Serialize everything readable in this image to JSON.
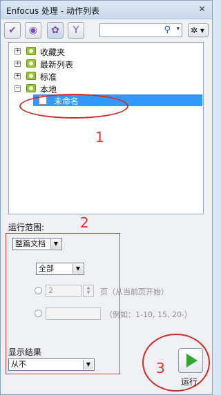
{
  "window": {
    "title": "Enfocus 处理 - 动作列表",
    "close_glyph": "✕"
  },
  "toolbar": {
    "buttons": [
      {
        "name": "checkmark-icon",
        "glyph": "✔",
        "color": "#7b4fb5"
      },
      {
        "name": "globe-icon",
        "glyph": "◉",
        "color": "#7b4fb5"
      },
      {
        "name": "gear-icon",
        "glyph": "✿",
        "color": "#7b4fb5"
      },
      {
        "name": "filter-icon",
        "glyph": "Y",
        "color": "#7b4fb5"
      }
    ],
    "search": {
      "value": "",
      "icon": "⚲",
      "caret": "▾"
    },
    "gear_menu": {
      "glyph": "✲ ▾"
    }
  },
  "tree": {
    "nodes": [
      {
        "label": "收藏夹",
        "expander": "+"
      },
      {
        "label": "最新列表",
        "expander": "+"
      },
      {
        "label": "标准",
        "expander": "+"
      },
      {
        "label": "本地",
        "expander": "−"
      }
    ],
    "selected_child": {
      "label": "未命名"
    }
  },
  "annotations": {
    "one": "1",
    "two": "2",
    "three": "3"
  },
  "scope": {
    "label": "运行范围:",
    "document_select": "整篇文档",
    "pages_select": "全部",
    "page_field": "2",
    "page_suffix": "页（从当前页开始）",
    "range_hint": "（例如：1-10, 15, 20-）"
  },
  "results": {
    "label": "显示结果",
    "select": "从不"
  },
  "run": {
    "label": "运行"
  },
  "colors": {
    "accent": "#3399ff",
    "annotation": "#d32a2a",
    "play": "#33a532"
  }
}
